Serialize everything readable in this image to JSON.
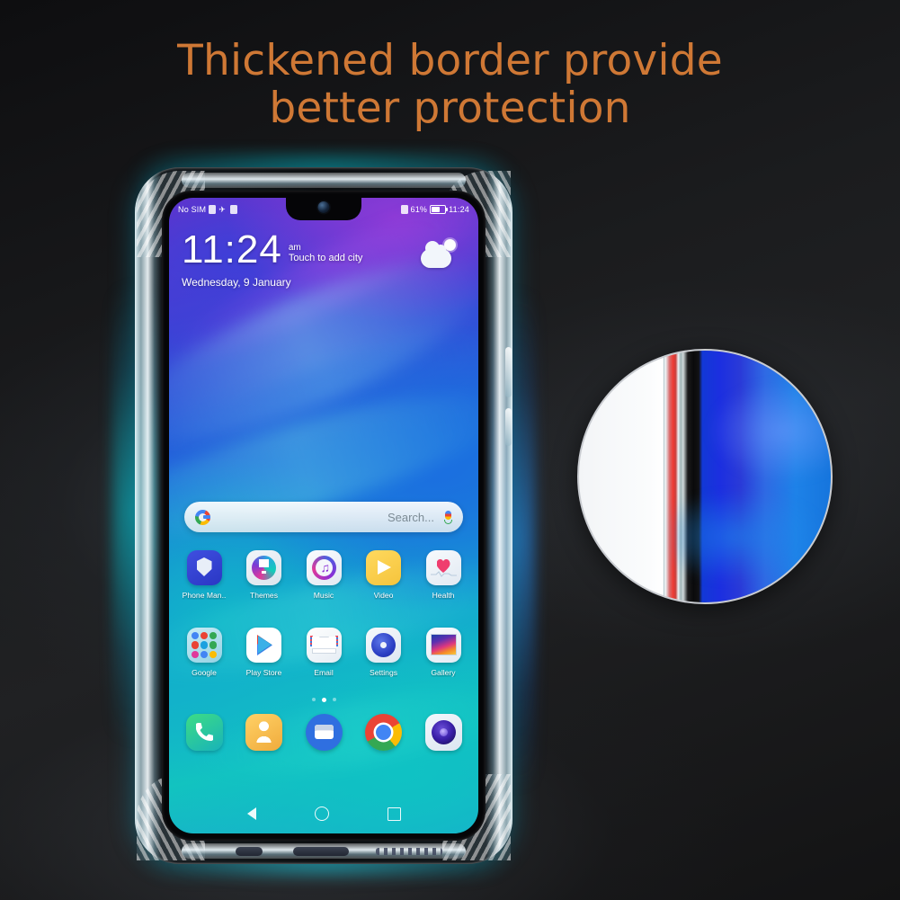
{
  "headline": {
    "line1": "Thickened border provide",
    "line2": "better protection",
    "color": "#cf7835"
  },
  "phone": {
    "status_bar": {
      "carrier": "No SIM",
      "airplane_icon": "airplane-icon",
      "sim_icon": "sim-card-icon",
      "vibrate_icon": "vibrate-icon",
      "battery_percent": "61%",
      "time": "11:24"
    },
    "lock_widget": {
      "time": "11:24",
      "ampm": "am",
      "city_hint": "Touch to add city",
      "date": "Wednesday, 9 January",
      "weather_icon": "partly-cloudy-icon"
    },
    "search": {
      "placeholder": "Search...",
      "google_icon": "google-g-icon",
      "mic_icon": "microphone-icon"
    },
    "app_rows": [
      [
        {
          "label": "Phone Man..",
          "icon": "phone-manager-icon"
        },
        {
          "label": "Themes",
          "icon": "themes-icon"
        },
        {
          "label": "Music",
          "icon": "music-icon"
        },
        {
          "label": "Video",
          "icon": "video-icon"
        },
        {
          "label": "Health",
          "icon": "health-icon"
        }
      ],
      [
        {
          "label": "Google",
          "icon": "google-folder-icon"
        },
        {
          "label": "Play Store",
          "icon": "play-store-icon"
        },
        {
          "label": "Email",
          "icon": "email-icon"
        },
        {
          "label": "Settings",
          "icon": "settings-icon"
        },
        {
          "label": "Gallery",
          "icon": "gallery-icon"
        }
      ]
    ],
    "dock": [
      {
        "label": "Phone",
        "icon": "phone-dialer-icon"
      },
      {
        "label": "Contacts",
        "icon": "contacts-icon"
      },
      {
        "label": "Messages",
        "icon": "messages-icon"
      },
      {
        "label": "Chrome",
        "icon": "chrome-icon"
      },
      {
        "label": "Camera",
        "icon": "camera-icon"
      }
    ],
    "page_indicator": {
      "total": 3,
      "active": 2
    },
    "nav_bar": [
      {
        "icon": "back-triangle-icon"
      },
      {
        "icon": "home-circle-icon"
      },
      {
        "icon": "recents-square-icon"
      }
    ]
  },
  "magnifier": {
    "name": "edge-cross-section-magnifier",
    "border_color": "#c9ccd1"
  },
  "folder_mini_colors": [
    "#4285f4",
    "#ea4335",
    "#34a853",
    "#ea4335",
    "#1aa1e0",
    "#34a853",
    "#e0399a",
    "#4285f4",
    "#fbbc05"
  ]
}
